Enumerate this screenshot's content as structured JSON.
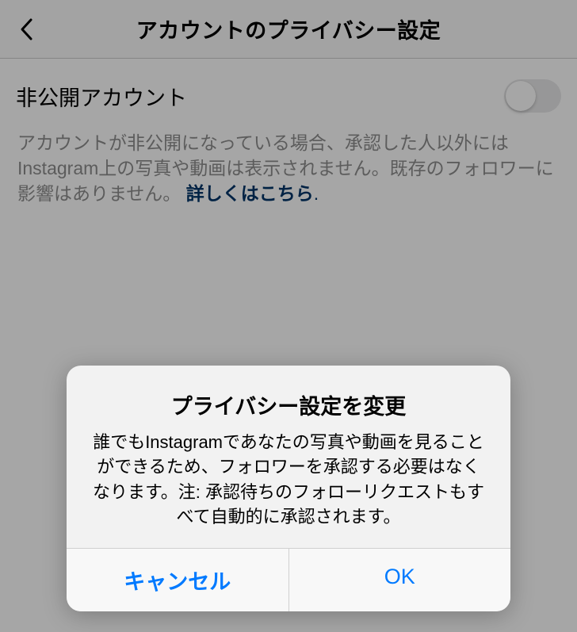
{
  "header": {
    "title": "アカウントのプライバシー設定"
  },
  "setting": {
    "label": "非公開アカウント",
    "toggle_on": false
  },
  "description": {
    "text": "アカウントが非公開になっている場合、承認した人以外にはInstagram上の写真や動画は表示されません。既存のフォロワーに影響はありません。",
    "link_text": "詳しくはこちら",
    "period": "."
  },
  "dialog": {
    "title": "プライバシー設定を変更",
    "message": "誰でもInstagramであなたの写真や動画を見ることができるため、フォロワーを承認する必要はなくなります。注: 承認待ちのフォローリクエストもすべて自動的に承認されます。",
    "cancel_label": "キャンセル",
    "ok_label": "OK"
  }
}
